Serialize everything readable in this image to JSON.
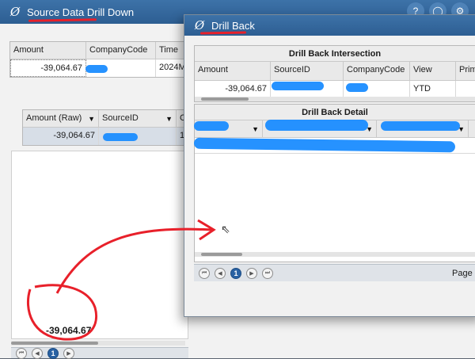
{
  "background_window": {
    "title": "Source Data Drill Down",
    "controls": [
      "?",
      "◯",
      "⚙"
    ],
    "top_grid": {
      "headers": [
        "Amount",
        "CompanyCode",
        "Time"
      ],
      "row": {
        "amount": "-39,064.67",
        "time": "2024M"
      }
    },
    "raw_grid": {
      "headers": [
        "Amount (Raw)",
        "SourceID",
        "C"
      ],
      "row": {
        "amount": "-39,064.67",
        "extra": "1"
      }
    },
    "total": "-39,064.67",
    "pager": {
      "current_page": "1"
    }
  },
  "drill_back_window": {
    "title": "Drill Back",
    "intersection": {
      "title": "Drill Back Intersection",
      "headers": [
        "Amount",
        "SourceID",
        "CompanyCode",
        "View",
        "Prim"
      ],
      "row": {
        "amount": "-39,064.67",
        "view": "YTD"
      }
    },
    "detail": {
      "title": "Drill Back Detail"
    },
    "pager": {
      "current_page": "1",
      "page_label": "Page"
    }
  },
  "colors": {
    "titlebar": "#2d5e92",
    "annotation": "#e8202a",
    "redaction": "#1a8cff",
    "pager_active": "#2a62a3"
  },
  "icons": {
    "logo": "onestream-logo-icon",
    "filter": "filter-icon",
    "cursor": "mouse-cursor-icon"
  }
}
